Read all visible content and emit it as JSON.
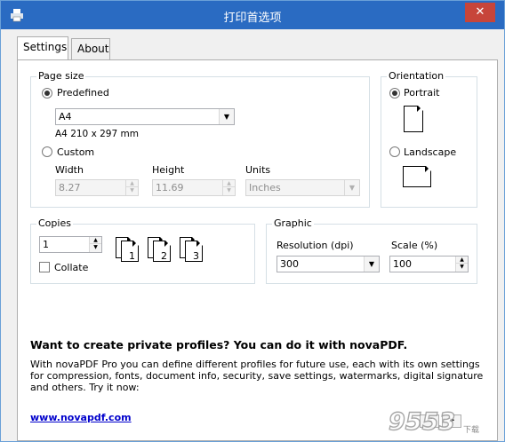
{
  "window": {
    "title": "打印首选项",
    "close_glyph": "✕"
  },
  "tabs": [
    {
      "label": "Settings",
      "active": true
    },
    {
      "label": "About",
      "active": false
    }
  ],
  "page_size": {
    "group_label": "Page size",
    "predefined_label": "Predefined",
    "predefined_selected": true,
    "paper_value": "A4",
    "paper_dims": "A4 210 x 297 mm",
    "custom_label": "Custom",
    "width_label": "Width",
    "width_value": "8.27",
    "height_label": "Height",
    "height_value": "11.69",
    "units_label": "Units",
    "units_value": "Inches"
  },
  "orientation": {
    "group_label": "Orientation",
    "portrait_label": "Portrait",
    "landscape_label": "Landscape",
    "selected": "Portrait"
  },
  "copies": {
    "group_label": "Copies",
    "value": "1",
    "collate_label": "Collate",
    "collate_checked": false,
    "collate_pages": [
      "1",
      "2",
      "3"
    ]
  },
  "graphic": {
    "group_label": "Graphic",
    "resolution_label": "Resolution (dpi)",
    "resolution_value": "300",
    "scale_label": "Scale (%)",
    "scale_value": "100"
  },
  "promo": {
    "title": "Want to create private profiles? You can do it with novaPDF.",
    "body": "With novaPDF Pro you can define different profiles for future use, each with its own settings for compression, fonts, document info, security, save settings, watermarks, digital signature and others. Try it now:",
    "link": "www.novapdf.com"
  },
  "nav": {
    "prev_glyph": "<",
    "next_glyph": ">"
  },
  "watermark": {
    "text": "9553",
    "sub": "下载"
  },
  "colors": {
    "titlebar": "#2a6bc2",
    "close": "#c7453a",
    "link": "#0000cc"
  }
}
